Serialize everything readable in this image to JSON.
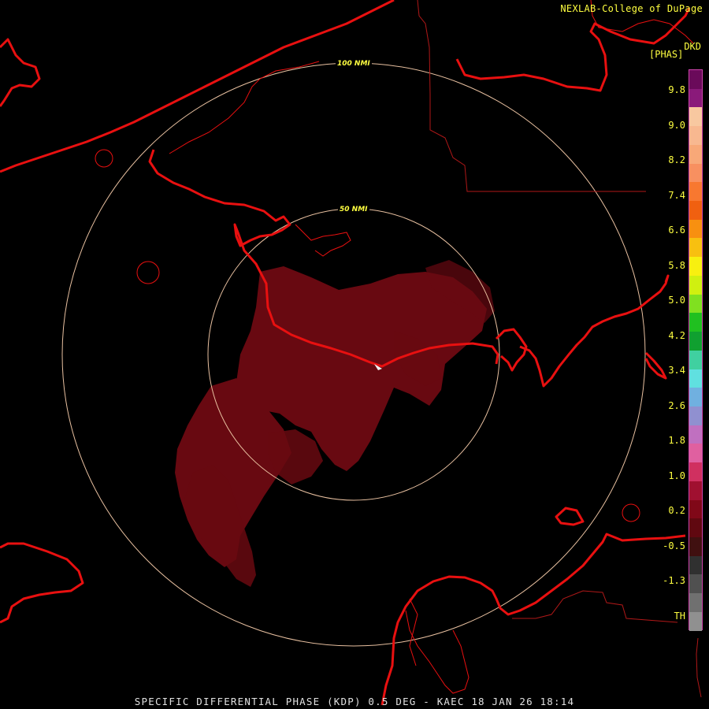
{
  "header": {
    "credit": "NEXLAB-College of DuPage",
    "product_code": "DKD",
    "units": "[PHAS]"
  },
  "range_rings": {
    "inner_label": "50 NMI",
    "outer_label": "100 NMI"
  },
  "colorbar": {
    "labels": [
      "9.8",
      "9.0",
      "8.2",
      "7.4",
      "6.6",
      "5.8",
      "5.0",
      "4.2",
      "3.4",
      "2.6",
      "1.8",
      "1.0",
      "0.2",
      "-0.5",
      "-1.3",
      "TH"
    ],
    "colors": [
      "#6a0a5a",
      "#8a1a7a",
      "#f8c8a0",
      "#f8b890",
      "#f8a878",
      "#f89060",
      "#f87830",
      "#f06010",
      "#f89010",
      "#f8c010",
      "#f8f010",
      "#d0f010",
      "#80e020",
      "#20c020",
      "#10a030",
      "#40d0a0",
      "#60e0e0",
      "#70b0e0",
      "#9090d0",
      "#c070c0",
      "#e060a0",
      "#d03060",
      "#a01030",
      "#800818",
      "#600810",
      "#401010",
      "#303030",
      "#505050",
      "#707070",
      "#909090"
    ]
  },
  "footer": {
    "caption": "SPECIFIC DIFFERENTIAL PHASE (KDP) 0.5 DEG - KAEC 18 JAN 26 18:14"
  }
}
